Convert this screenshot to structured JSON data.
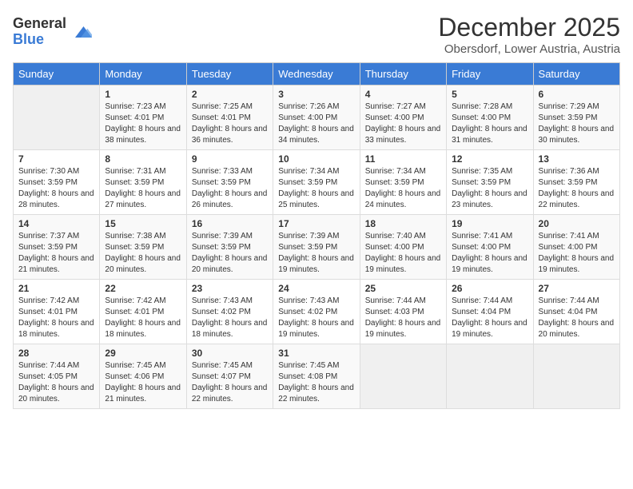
{
  "logo": {
    "general": "General",
    "blue": "Blue"
  },
  "title": "December 2025",
  "subtitle": "Obersdorf, Lower Austria, Austria",
  "days_header": [
    "Sunday",
    "Monday",
    "Tuesday",
    "Wednesday",
    "Thursday",
    "Friday",
    "Saturday"
  ],
  "weeks": [
    [
      {
        "day": "",
        "sunrise": "",
        "sunset": "",
        "daylight": ""
      },
      {
        "day": "1",
        "sunrise": "Sunrise: 7:23 AM",
        "sunset": "Sunset: 4:01 PM",
        "daylight": "Daylight: 8 hours and 38 minutes."
      },
      {
        "day": "2",
        "sunrise": "Sunrise: 7:25 AM",
        "sunset": "Sunset: 4:01 PM",
        "daylight": "Daylight: 8 hours and 36 minutes."
      },
      {
        "day": "3",
        "sunrise": "Sunrise: 7:26 AM",
        "sunset": "Sunset: 4:00 PM",
        "daylight": "Daylight: 8 hours and 34 minutes."
      },
      {
        "day": "4",
        "sunrise": "Sunrise: 7:27 AM",
        "sunset": "Sunset: 4:00 PM",
        "daylight": "Daylight: 8 hours and 33 minutes."
      },
      {
        "day": "5",
        "sunrise": "Sunrise: 7:28 AM",
        "sunset": "Sunset: 4:00 PM",
        "daylight": "Daylight: 8 hours and 31 minutes."
      },
      {
        "day": "6",
        "sunrise": "Sunrise: 7:29 AM",
        "sunset": "Sunset: 3:59 PM",
        "daylight": "Daylight: 8 hours and 30 minutes."
      }
    ],
    [
      {
        "day": "7",
        "sunrise": "Sunrise: 7:30 AM",
        "sunset": "Sunset: 3:59 PM",
        "daylight": "Daylight: 8 hours and 28 minutes."
      },
      {
        "day": "8",
        "sunrise": "Sunrise: 7:31 AM",
        "sunset": "Sunset: 3:59 PM",
        "daylight": "Daylight: 8 hours and 27 minutes."
      },
      {
        "day": "9",
        "sunrise": "Sunrise: 7:33 AM",
        "sunset": "Sunset: 3:59 PM",
        "daylight": "Daylight: 8 hours and 26 minutes."
      },
      {
        "day": "10",
        "sunrise": "Sunrise: 7:34 AM",
        "sunset": "Sunset: 3:59 PM",
        "daylight": "Daylight: 8 hours and 25 minutes."
      },
      {
        "day": "11",
        "sunrise": "Sunrise: 7:34 AM",
        "sunset": "Sunset: 3:59 PM",
        "daylight": "Daylight: 8 hours and 24 minutes."
      },
      {
        "day": "12",
        "sunrise": "Sunrise: 7:35 AM",
        "sunset": "Sunset: 3:59 PM",
        "daylight": "Daylight: 8 hours and 23 minutes."
      },
      {
        "day": "13",
        "sunrise": "Sunrise: 7:36 AM",
        "sunset": "Sunset: 3:59 PM",
        "daylight": "Daylight: 8 hours and 22 minutes."
      }
    ],
    [
      {
        "day": "14",
        "sunrise": "Sunrise: 7:37 AM",
        "sunset": "Sunset: 3:59 PM",
        "daylight": "Daylight: 8 hours and 21 minutes."
      },
      {
        "day": "15",
        "sunrise": "Sunrise: 7:38 AM",
        "sunset": "Sunset: 3:59 PM",
        "daylight": "Daylight: 8 hours and 20 minutes."
      },
      {
        "day": "16",
        "sunrise": "Sunrise: 7:39 AM",
        "sunset": "Sunset: 3:59 PM",
        "daylight": "Daylight: 8 hours and 20 minutes."
      },
      {
        "day": "17",
        "sunrise": "Sunrise: 7:39 AM",
        "sunset": "Sunset: 3:59 PM",
        "daylight": "Daylight: 8 hours and 19 minutes."
      },
      {
        "day": "18",
        "sunrise": "Sunrise: 7:40 AM",
        "sunset": "Sunset: 4:00 PM",
        "daylight": "Daylight: 8 hours and 19 minutes."
      },
      {
        "day": "19",
        "sunrise": "Sunrise: 7:41 AM",
        "sunset": "Sunset: 4:00 PM",
        "daylight": "Daylight: 8 hours and 19 minutes."
      },
      {
        "day": "20",
        "sunrise": "Sunrise: 7:41 AM",
        "sunset": "Sunset: 4:00 PM",
        "daylight": "Daylight: 8 hours and 19 minutes."
      }
    ],
    [
      {
        "day": "21",
        "sunrise": "Sunrise: 7:42 AM",
        "sunset": "Sunset: 4:01 PM",
        "daylight": "Daylight: 8 hours and 18 minutes."
      },
      {
        "day": "22",
        "sunrise": "Sunrise: 7:42 AM",
        "sunset": "Sunset: 4:01 PM",
        "daylight": "Daylight: 8 hours and 18 minutes."
      },
      {
        "day": "23",
        "sunrise": "Sunrise: 7:43 AM",
        "sunset": "Sunset: 4:02 PM",
        "daylight": "Daylight: 8 hours and 18 minutes."
      },
      {
        "day": "24",
        "sunrise": "Sunrise: 7:43 AM",
        "sunset": "Sunset: 4:02 PM",
        "daylight": "Daylight: 8 hours and 19 minutes."
      },
      {
        "day": "25",
        "sunrise": "Sunrise: 7:44 AM",
        "sunset": "Sunset: 4:03 PM",
        "daylight": "Daylight: 8 hours and 19 minutes."
      },
      {
        "day": "26",
        "sunrise": "Sunrise: 7:44 AM",
        "sunset": "Sunset: 4:04 PM",
        "daylight": "Daylight: 8 hours and 19 minutes."
      },
      {
        "day": "27",
        "sunrise": "Sunrise: 7:44 AM",
        "sunset": "Sunset: 4:04 PM",
        "daylight": "Daylight: 8 hours and 20 minutes."
      }
    ],
    [
      {
        "day": "28",
        "sunrise": "Sunrise: 7:44 AM",
        "sunset": "Sunset: 4:05 PM",
        "daylight": "Daylight: 8 hours and 20 minutes."
      },
      {
        "day": "29",
        "sunrise": "Sunrise: 7:45 AM",
        "sunset": "Sunset: 4:06 PM",
        "daylight": "Daylight: 8 hours and 21 minutes."
      },
      {
        "day": "30",
        "sunrise": "Sunrise: 7:45 AM",
        "sunset": "Sunset: 4:07 PM",
        "daylight": "Daylight: 8 hours and 22 minutes."
      },
      {
        "day": "31",
        "sunrise": "Sunrise: 7:45 AM",
        "sunset": "Sunset: 4:08 PM",
        "daylight": "Daylight: 8 hours and 22 minutes."
      },
      {
        "day": "",
        "sunrise": "",
        "sunset": "",
        "daylight": ""
      },
      {
        "day": "",
        "sunrise": "",
        "sunset": "",
        "daylight": ""
      },
      {
        "day": "",
        "sunrise": "",
        "sunset": "",
        "daylight": ""
      }
    ]
  ]
}
